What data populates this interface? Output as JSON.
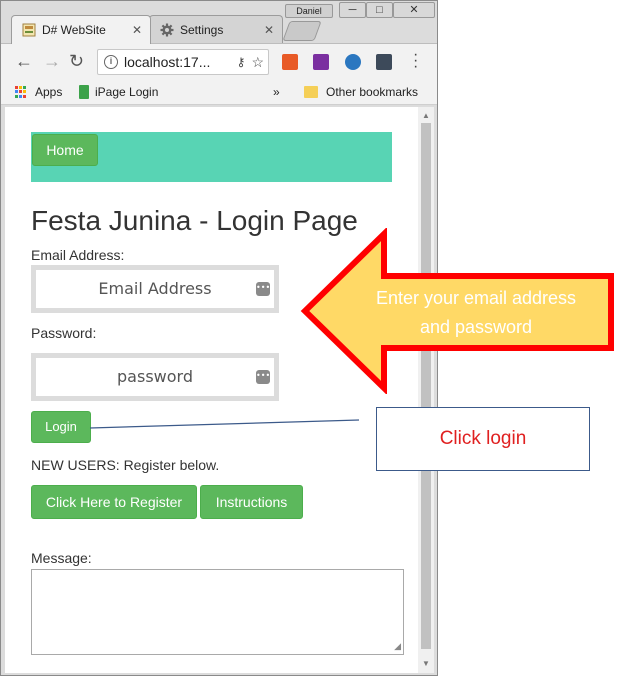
{
  "browser": {
    "tabs": [
      {
        "label": "D# WebSite",
        "icon": "website-favicon-icon",
        "active": true
      },
      {
        "label": "Settings",
        "icon": "gear-icon",
        "active": false
      }
    ],
    "profile_label": "Daniel",
    "window_buttons": {
      "minimize": "─",
      "maximize": "□",
      "close": "✕"
    },
    "url": "localhost:17...",
    "bookmarks": {
      "apps_label": "Apps",
      "ipage_label": "iPage Login",
      "overflow": "»",
      "other_label": "Other bookmarks"
    },
    "colors": {
      "chrome_frame": "#dcdcdc",
      "toolbar": "#f2f2f2"
    }
  },
  "page": {
    "nav": {
      "home_label": "Home"
    },
    "title": "Festa Junina - Login Page",
    "email": {
      "label": "Email Address:",
      "placeholder": "Email Address"
    },
    "password": {
      "label": "Password:",
      "placeholder": "password"
    },
    "login_label": "Login",
    "new_users_text": "NEW USERS: Register below.",
    "register_label": "Click Here to Register",
    "instructions_label": "Instructions",
    "message_label": "Message:",
    "colors": {
      "navbar": "#58d4b4",
      "button": "#5cb85c"
    }
  },
  "annotations": {
    "arrow_text_line1": "Enter your email address",
    "arrow_text_line2": "and password",
    "callout_text": "Click login",
    "colors": {
      "arrow_fill": "#ffd966",
      "arrow_border": "#ff0000",
      "callout_text": "#e02020"
    }
  }
}
